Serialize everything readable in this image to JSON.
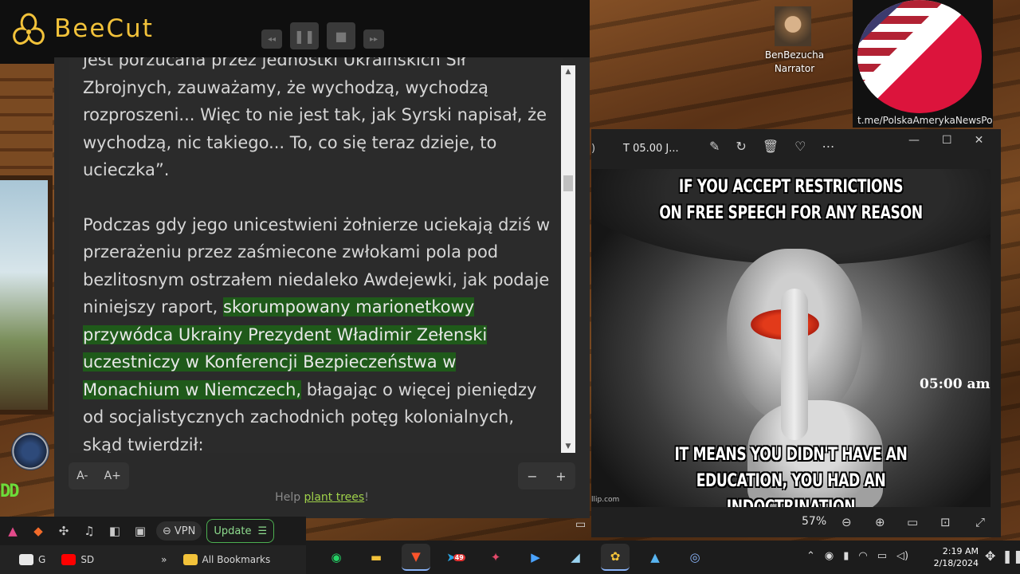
{
  "beecut": {
    "title": "BeeCut",
    "controls": {
      "rewind": "◂◂",
      "pause": "❚❚",
      "stop": "■",
      "forward": "▸▸"
    }
  },
  "reader": {
    "paragraph1": "jest porzucana przez jednostki Ukraińskich Sił Zbrojnych, zauważamy, że wychodzą, wychodzą rozproszeni... Więc to nie jest tak, jak Syrski napisał, że wychodzą, nic takiego... To, co się teraz dzieje, to ucieczka”.",
    "paragraph2_before": "Podczas gdy jego unicestwieni żołnierze uciekają dziś w przerażeniu przez zaśmiecone zwłokami pola pod bezlitosnym ostrzałem niedaleko Awdejewki, jak podaje niniejszy raport, ",
    "paragraph2_highlight": "skorumpowany marionetkowy przywódca Ukrainy Prezydent Władimir Zełenski uczestniczy w Konferencji Bezpieczeństwa w Monachium w Niemczech,",
    "paragraph2_after": " błagając o więcej pieniędzy od socjalistycznych zachodnich potęg kolonialnych, skąd twierdził:",
    "font_decrease": "A-",
    "font_increase": "A+",
    "zoom_minus": "−",
    "zoom_plus": "+",
    "help_prefix": "Help ",
    "help_link": "plant trees",
    "help_suffix": "!"
  },
  "left_strip": {
    "green_text": "DD"
  },
  "browser": {
    "vpn_label": "VPN",
    "update_label": "Update",
    "bookmarks": [
      {
        "label": "G",
        "color": "#e8e8e8"
      },
      {
        "label": "SD",
        "color": "#ff0000"
      }
    ],
    "overflow": "»",
    "all_bookmarks": "All Bookmarks"
  },
  "desktop": {
    "avatar_name": "BenBezucha",
    "avatar_role": "Narrator",
    "flag_link": "t.me/PolskaAmerykaNewsPo"
  },
  "viewer": {
    "paren": ")",
    "title": "T 05.00 J...",
    "zoom": "57%",
    "meme_top_1": "IF YOU ACCEPT RESTRICTIONS",
    "meme_top_2": "ON FREE SPEECH FOR ANY REASON",
    "meme_bottom_1": "IT MEANS YOU DIDN'T HAVE AN",
    "meme_bottom_2": "EDUCATION, YOU HAD AN INDOCTRINATION",
    "meme_time": "05:00 am",
    "meme_credit": "llip.com"
  },
  "taskbar": {
    "time": "2:19 AM",
    "date": "2/18/2024",
    "telegram_badge": "49"
  },
  "colors": {
    "beecut_gold": "#f2c23a",
    "highlight": "#1f5a1a",
    "link_green": "#9fd14a",
    "update_green": "#4caf50"
  }
}
